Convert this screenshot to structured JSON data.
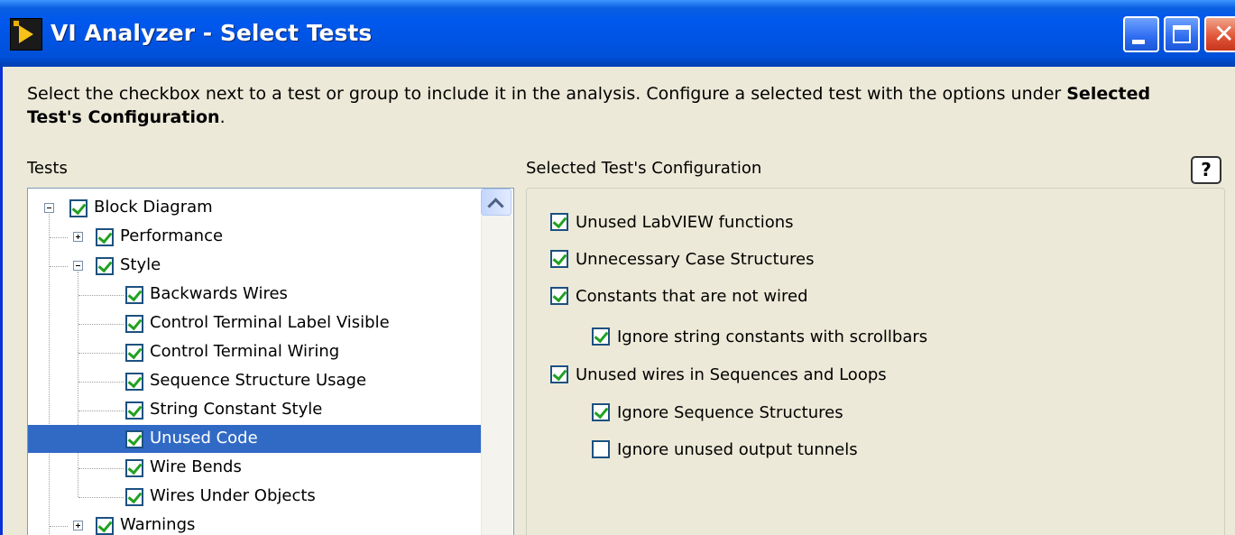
{
  "window": {
    "title": "VI Analyzer - Select Tests"
  },
  "instructions": {
    "line1_prefix": "Select the checkbox next to a test or group to include it in the analysis.  Configure a selected test with the options under ",
    "line1_bold": "Selected",
    "line2_bold": "Test's Configuration",
    "line2_suffix": "."
  },
  "tests": {
    "label": "Tests",
    "tree": [
      {
        "label": "Block Diagram",
        "level": 0,
        "expander": "minus",
        "checked": true
      },
      {
        "label": "Performance",
        "level": 1,
        "expander": "plus",
        "checked": true
      },
      {
        "label": "Style",
        "level": 1,
        "expander": "minus",
        "checked": true
      },
      {
        "label": "Backwards Wires",
        "level": 2,
        "checked": true
      },
      {
        "label": "Control Terminal Label Visible",
        "level": 2,
        "checked": true
      },
      {
        "label": "Control Terminal Wiring",
        "level": 2,
        "checked": true
      },
      {
        "label": "Sequence Structure Usage",
        "level": 2,
        "checked": true
      },
      {
        "label": "String Constant Style",
        "level": 2,
        "checked": true
      },
      {
        "label": "Unused Code",
        "level": 2,
        "checked": true,
        "selected": true
      },
      {
        "label": "Wire Bends",
        "level": 2,
        "checked": true
      },
      {
        "label": "Wires Under Objects",
        "level": 2,
        "checked": true
      },
      {
        "label": "Warnings",
        "level": 1,
        "expander": "plus",
        "checked": true
      }
    ]
  },
  "config": {
    "label": "Selected Test's Configuration",
    "help_glyph": "?",
    "options": [
      {
        "label": "Unused LabVIEW functions",
        "checked": true,
        "indent": 0
      },
      {
        "label": "Unnecessary Case Structures",
        "checked": true,
        "indent": 0
      },
      {
        "label": "Constants that are not wired",
        "checked": true,
        "indent": 0
      },
      {
        "label": "Ignore string constants with scrollbars",
        "checked": true,
        "indent": 1
      },
      {
        "label": "Unused wires in Sequences and Loops",
        "checked": true,
        "indent": 0
      },
      {
        "label": "Ignore Sequence Structures",
        "checked": true,
        "indent": 1
      },
      {
        "label": "Ignore unused output tunnels",
        "checked": false,
        "indent": 1
      }
    ]
  },
  "colors": {
    "titlebar": "#0054E3",
    "selection": "#316AC5",
    "check": "#21A121",
    "dialog_bg": "#ECE9D8"
  }
}
